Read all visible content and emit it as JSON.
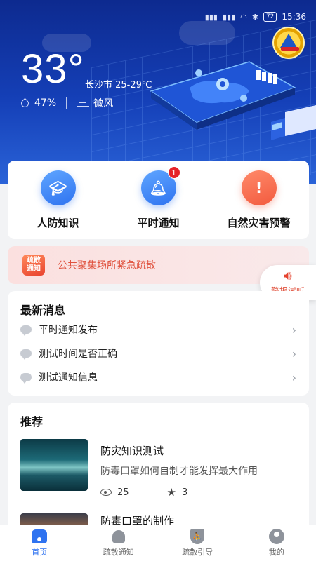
{
  "status_bar": {
    "time": "15:36",
    "battery": "72"
  },
  "weather": {
    "temperature": "33°",
    "city_range": "长沙市 25-29℃",
    "humidity": "47%",
    "wind": "微风"
  },
  "quick_actions": [
    {
      "label": "人防知识",
      "icon": "graduation-cap-icon"
    },
    {
      "label": "平时通知",
      "icon": "bell-icon",
      "badge": "1"
    },
    {
      "label": "自然灾害预警",
      "icon": "warning-icon"
    }
  ],
  "alert_banner": {
    "tag_line1": "疏散",
    "tag_line2": "通知",
    "text": "公共聚集场所紧急疏散"
  },
  "alarm_test": {
    "label": "警报试听"
  },
  "news": {
    "title": "最新消息",
    "items": [
      "平时通知发布",
      "测试时间是否正确",
      "测试通知信息"
    ]
  },
  "recommend": {
    "title": "推荐",
    "items": [
      {
        "title": "防灾知识测试",
        "desc": "防毒口罩如何自制才能发挥最大作用",
        "views": "25",
        "stars": "3"
      },
      {
        "title": "防毒口罩的制作",
        "desc": ""
      }
    ]
  },
  "tabs": [
    {
      "label": "首页",
      "active": true
    },
    {
      "label": "疏散通知"
    },
    {
      "label": "疏散引导"
    },
    {
      "label": "我的"
    }
  ],
  "colors": {
    "primary": "#2f73f0",
    "alert": "#e0523e",
    "hero": "#1540b8"
  }
}
